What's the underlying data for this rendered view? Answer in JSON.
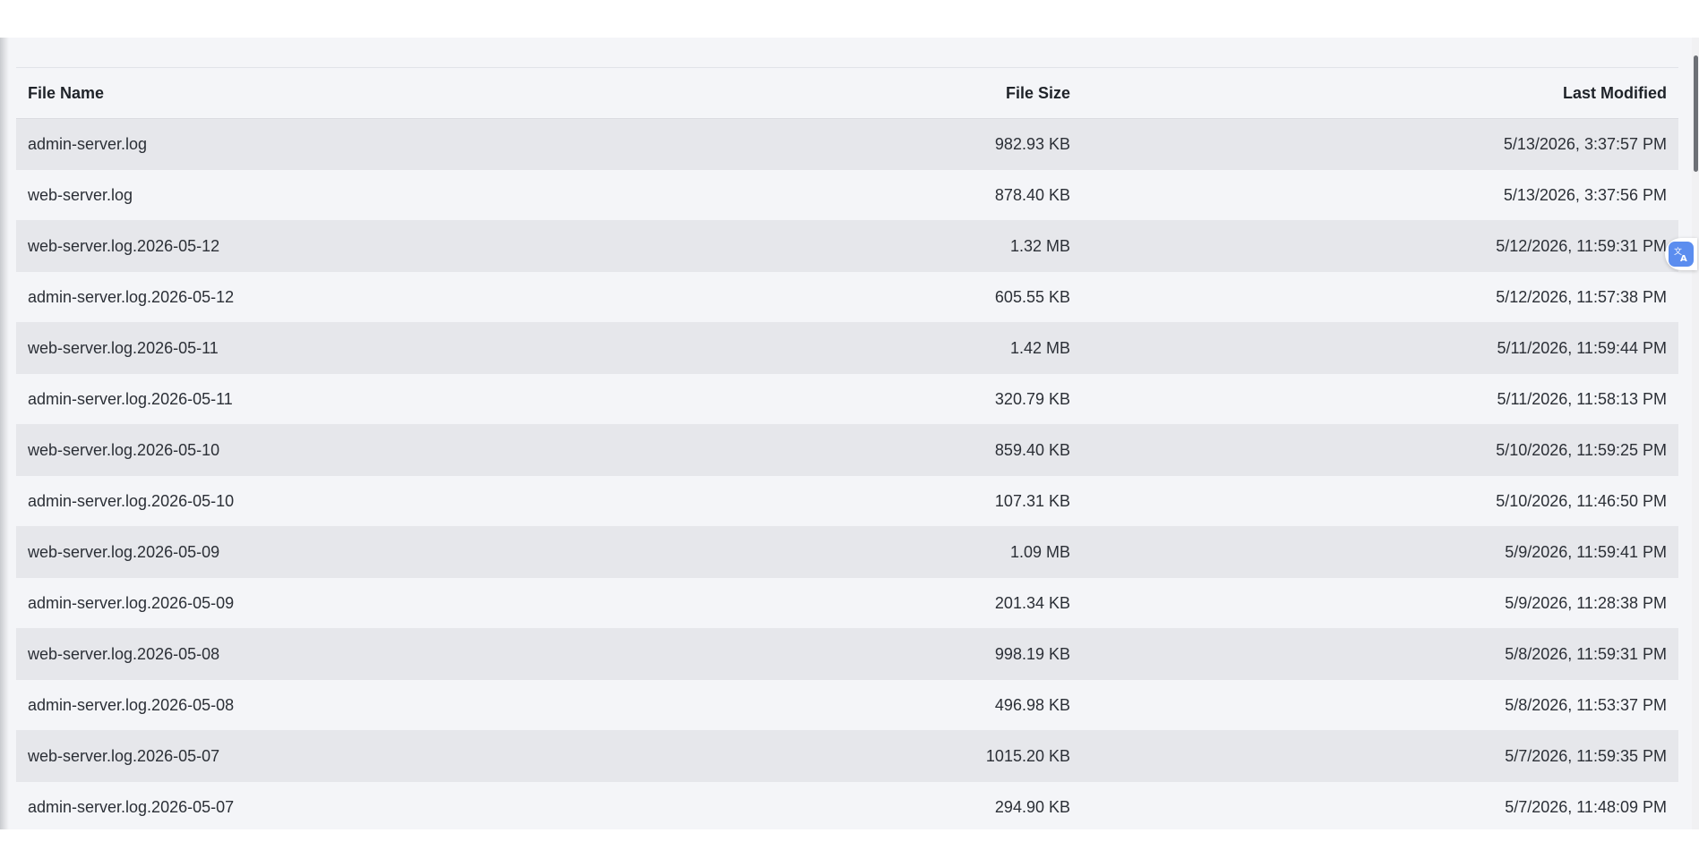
{
  "table": {
    "headers": {
      "file_name": "File Name",
      "file_size": "File Size",
      "last_modified": "Last Modified"
    },
    "rows": [
      {
        "name": "admin-server.log",
        "size": "982.93 KB",
        "modified": "5/13/2026, 3:37:57 PM"
      },
      {
        "name": "web-server.log",
        "size": "878.40 KB",
        "modified": "5/13/2026, 3:37:56 PM"
      },
      {
        "name": "web-server.log.2026-05-12",
        "size": "1.32 MB",
        "modified": "5/12/2026, 11:59:31 PM"
      },
      {
        "name": "admin-server.log.2026-05-12",
        "size": "605.55 KB",
        "modified": "5/12/2026, 11:57:38 PM"
      },
      {
        "name": "web-server.log.2026-05-11",
        "size": "1.42 MB",
        "modified": "5/11/2026, 11:59:44 PM"
      },
      {
        "name": "admin-server.log.2026-05-11",
        "size": "320.79 KB",
        "modified": "5/11/2026, 11:58:13 PM"
      },
      {
        "name": "web-server.log.2026-05-10",
        "size": "859.40 KB",
        "modified": "5/10/2026, 11:59:25 PM"
      },
      {
        "name": "admin-server.log.2026-05-10",
        "size": "107.31 KB",
        "modified": "5/10/2026, 11:46:50 PM"
      },
      {
        "name": "web-server.log.2026-05-09",
        "size": "1.09 MB",
        "modified": "5/9/2026, 11:59:41 PM"
      },
      {
        "name": "admin-server.log.2026-05-09",
        "size": "201.34 KB",
        "modified": "5/9/2026, 11:28:38 PM"
      },
      {
        "name": "web-server.log.2026-05-08",
        "size": "998.19 KB",
        "modified": "5/8/2026, 11:59:31 PM"
      },
      {
        "name": "admin-server.log.2026-05-08",
        "size": "496.98 KB",
        "modified": "5/8/2026, 11:53:37 PM"
      },
      {
        "name": "web-server.log.2026-05-07",
        "size": "1015.20 KB",
        "modified": "5/7/2026, 11:59:35 PM"
      },
      {
        "name": "admin-server.log.2026-05-07",
        "size": "294.90 KB",
        "modified": "5/7/2026, 11:48:09 PM"
      }
    ]
  },
  "translate_widget": {
    "icon": "translate-icon",
    "color": "#5b8def"
  }
}
